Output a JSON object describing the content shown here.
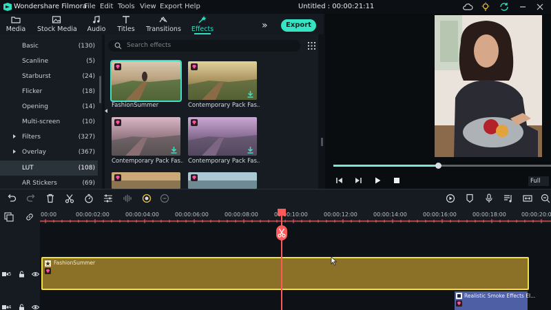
{
  "app": {
    "name": "Wondershare Filmora",
    "menu": [
      "File",
      "Edit",
      "Tools",
      "View",
      "Export",
      "Help"
    ],
    "doc_title": "Untitled : 00:00:21:11"
  },
  "tabs": [
    {
      "label": "Media",
      "icon": "folder-icon"
    },
    {
      "label": "Stock Media",
      "icon": "image-icon"
    },
    {
      "label": "Audio",
      "icon": "music-icon"
    },
    {
      "label": "Titles",
      "icon": "text-icon"
    },
    {
      "label": "Transitions",
      "icon": "transition-icon"
    },
    {
      "label": "Effects",
      "icon": "effects-icon",
      "active": true
    }
  ],
  "export_label": "Export",
  "sidebar": {
    "items": [
      {
        "label": "Basic",
        "count": "(130)"
      },
      {
        "label": "Scanline",
        "count": "(5)"
      },
      {
        "label": "Starburst",
        "count": "(24)"
      },
      {
        "label": "Flicker",
        "count": "(18)"
      },
      {
        "label": "Opening",
        "count": "(14)"
      },
      {
        "label": "Multi-screen",
        "count": "(10)"
      },
      {
        "label": "Filters",
        "count": "(327)",
        "expandable": true
      },
      {
        "label": "Overlay",
        "count": "(367)",
        "expandable": true
      },
      {
        "label": "LUT",
        "count": "(108)",
        "active": true
      },
      {
        "label": "AR Stickers",
        "count": "(69)"
      }
    ]
  },
  "search": {
    "placeholder": "Search effects"
  },
  "effects": [
    {
      "name": "FashionSummer",
      "selected": true
    },
    {
      "name": "Contemporary Pack Fas..."
    },
    {
      "name": "Contemporary Pack Fas..."
    },
    {
      "name": "Contemporary Pack Fas..."
    },
    {
      "name": ""
    },
    {
      "name": ""
    }
  ],
  "preview": {
    "progress": 0.48,
    "quality": "Full"
  },
  "timeline": {
    "timecodes": [
      "00:00",
      "00:00:02:00",
      "00:00:04:00",
      "00:00:06:00",
      "00:00:08:00",
      "00:00:10:00",
      "00:00:12:00",
      "00:00:14:00",
      "00:00:16:00",
      "00:00:18:00",
      "00:00:20:00"
    ],
    "tracks": [
      {
        "label": "5"
      },
      {
        "label": "4"
      }
    ],
    "clips": [
      {
        "name": "FashionSummer",
        "color": "#8b7128"
      },
      {
        "name": "Realistic Smoke Effects El...",
        "color": "#4f5fa6"
      }
    ]
  },
  "colors": {
    "accent": "#35e4c2",
    "playhead": "#ff5a5a",
    "clip_border": "#f1e04a"
  }
}
